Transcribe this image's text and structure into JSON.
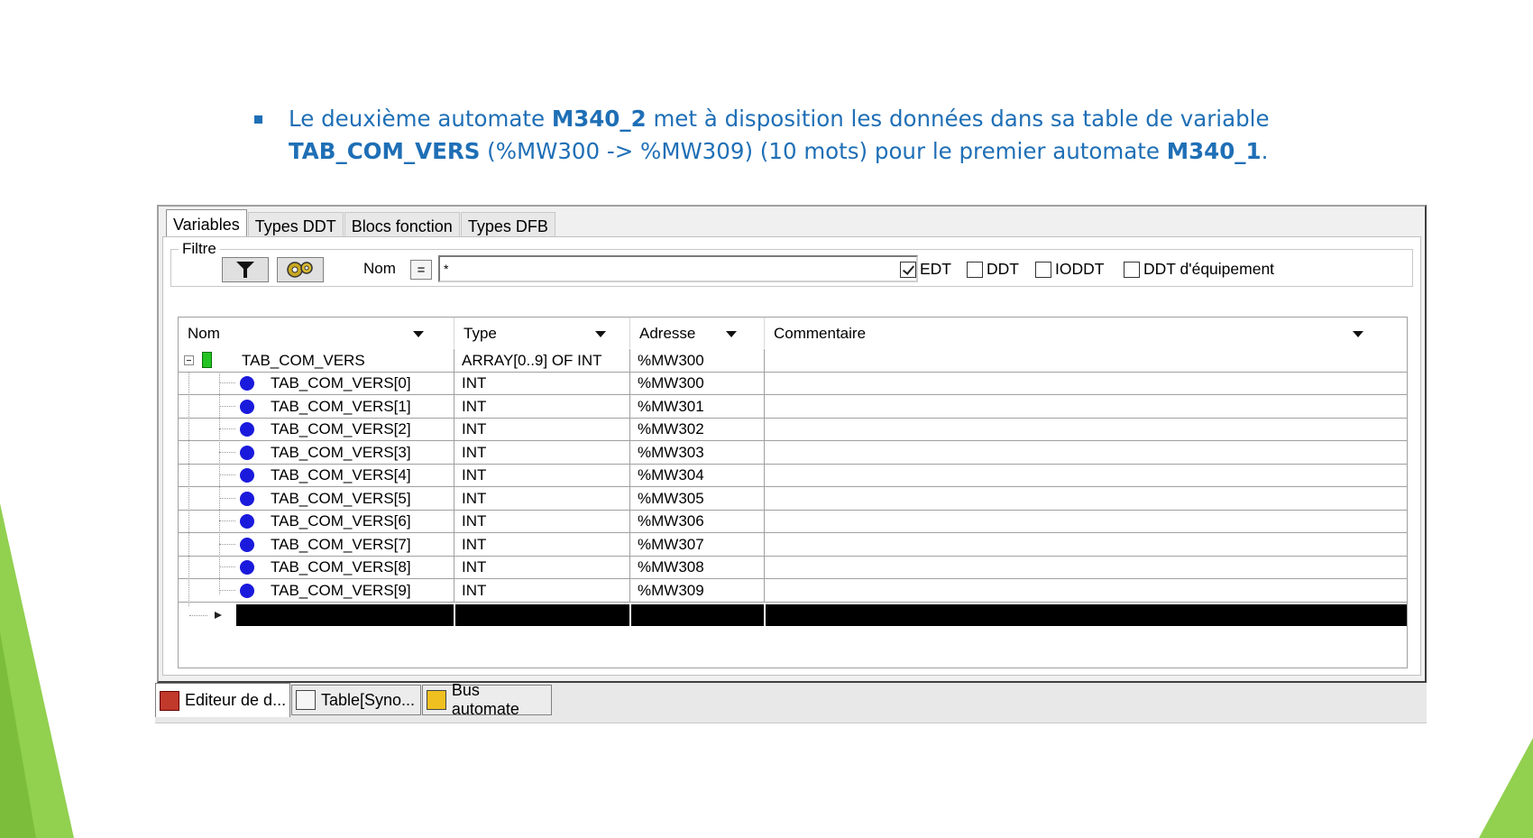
{
  "slide": {
    "line1_pre": "Le deuxième automate ",
    "line1_bold": "M340_2",
    "line1_post": " met à disposition les données dans sa table de variable",
    "line2_bold1": "TAB_COM_VERS",
    "line2_mid": " (%MW300 -> %MW309) (10 mots) pour le premier automate ",
    "line2_bold2": "M340_1",
    "line2_end": "."
  },
  "tabs": [
    "Variables",
    "Types DDT",
    "Blocs fonction",
    "Types DFB"
  ],
  "filter": {
    "label": "Filtre",
    "nom_label": "Nom",
    "eq_label": "=",
    "name_value": "*",
    "checkboxes": [
      {
        "label": "EDT",
        "checked": true
      },
      {
        "label": "DDT",
        "checked": false
      },
      {
        "label": "IODDT",
        "checked": false
      },
      {
        "label": "DDT d'équipement",
        "checked": false
      }
    ]
  },
  "grid": {
    "columns": [
      "Nom",
      "Type",
      "Adresse",
      "Commentaire"
    ],
    "parent": {
      "name": "TAB_COM_VERS",
      "type": "ARRAY[0..9] OF INT",
      "address": "%MW300",
      "comment": ""
    },
    "rows": [
      {
        "name": "TAB_COM_VERS[0]",
        "type": "INT",
        "address": "%MW300",
        "comment": ""
      },
      {
        "name": "TAB_COM_VERS[1]",
        "type": "INT",
        "address": "%MW301",
        "comment": ""
      },
      {
        "name": "TAB_COM_VERS[2]",
        "type": "INT",
        "address": "%MW302",
        "comment": ""
      },
      {
        "name": "TAB_COM_VERS[3]",
        "type": "INT",
        "address": "%MW303",
        "comment": ""
      },
      {
        "name": "TAB_COM_VERS[4]",
        "type": "INT",
        "address": "%MW304",
        "comment": ""
      },
      {
        "name": "TAB_COM_VERS[5]",
        "type": "INT",
        "address": "%MW305",
        "comment": ""
      },
      {
        "name": "TAB_COM_VERS[6]",
        "type": "INT",
        "address": "%MW306",
        "comment": ""
      },
      {
        "name": "TAB_COM_VERS[7]",
        "type": "INT",
        "address": "%MW307",
        "comment": ""
      },
      {
        "name": "TAB_COM_VERS[8]",
        "type": "INT",
        "address": "%MW308",
        "comment": ""
      },
      {
        "name": "TAB_COM_VERS[9]",
        "type": "INT",
        "address": "%MW309",
        "comment": ""
      }
    ]
  },
  "bottom_tabs": [
    "Editeur de d...",
    "Table[Syno...",
    "Bus automate"
  ],
  "colors": {
    "accent": "#1f6fb6",
    "decor_green": "#92d050",
    "variable_icon": "#1a1adc"
  }
}
